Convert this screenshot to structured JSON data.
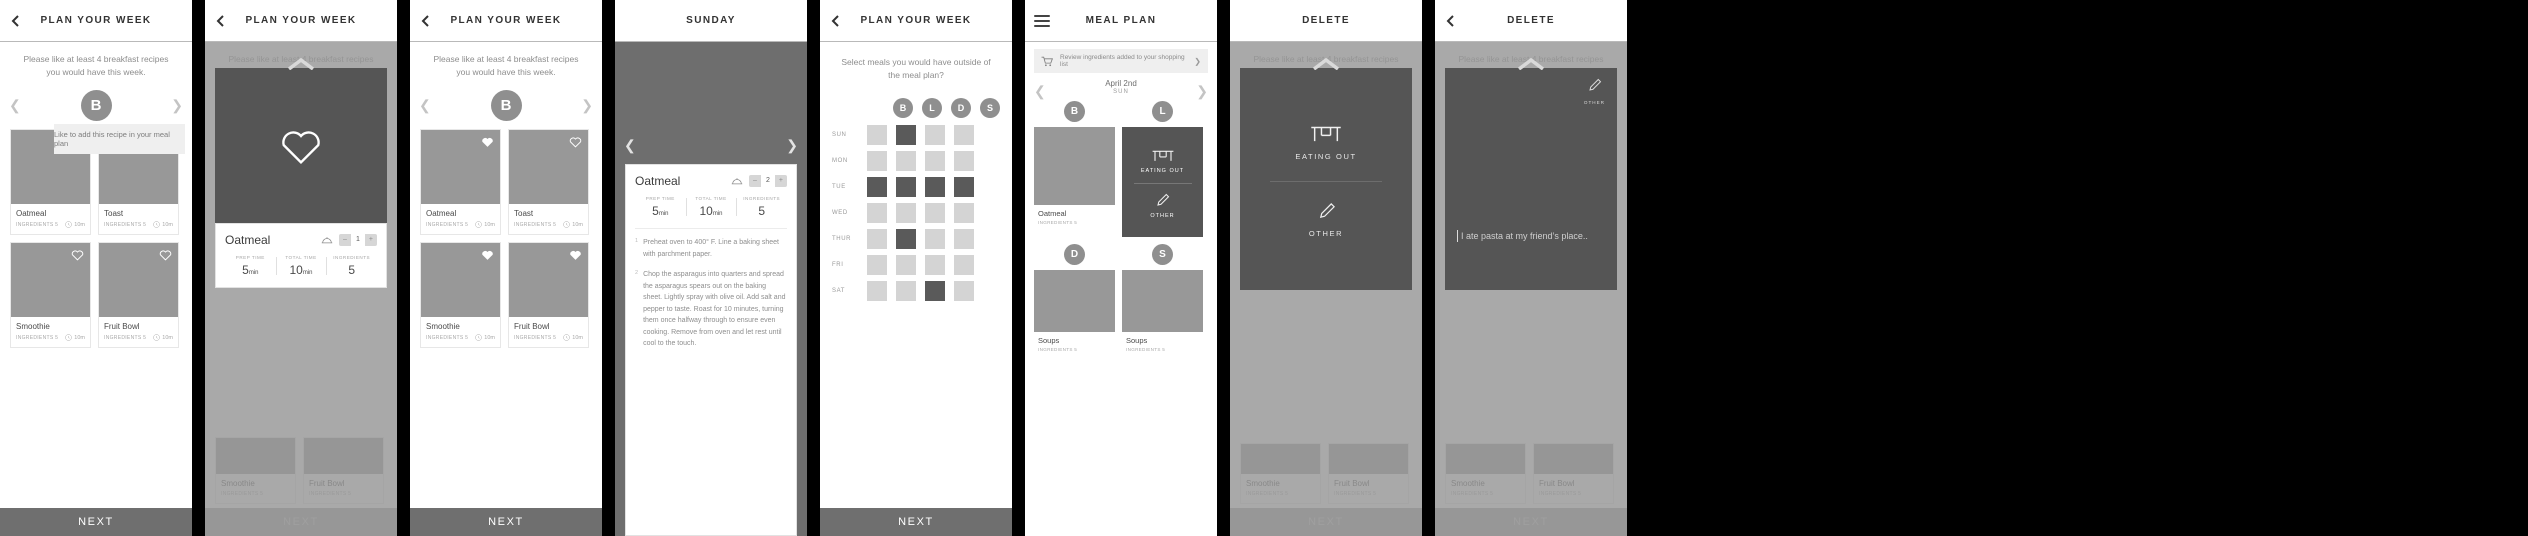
{
  "app": {
    "instruction": "Please like at least 4 breakfast recipes you would have this week.",
    "next_label": "NEXT"
  },
  "icons": {
    "back": "chevron-left-icon",
    "menu": "hamburger-menu-icon",
    "heart_outline": "heart-outline-icon",
    "heart_filled": "heart-filled-icon",
    "clock": "clock-icon",
    "dish": "dish-cloche-icon",
    "cart": "shopping-cart-icon",
    "table": "dining-table-icon",
    "pencil": "pencil-icon",
    "caret_up": "caret-up-icon"
  },
  "panels": [
    {
      "id": "plan-week-tooltip",
      "title": "PLAN YOUR WEEK",
      "day_letter": "B",
      "tooltip": "Like to add this recipe in your meal plan",
      "recipes": [
        {
          "name": "Oatmeal",
          "ingredients": "INGREDIENTS 5",
          "time": "10m",
          "liked": false
        },
        {
          "name": "Toast",
          "ingredients": "INGREDIENTS 5",
          "time": "10m",
          "liked": false
        },
        {
          "name": "Smoothie",
          "ingredients": "INGREDIENTS 5",
          "time": "10m",
          "liked": false
        },
        {
          "name": "Fruit Bowl",
          "ingredients": "INGREDIENTS 5",
          "time": "10m",
          "liked": false
        }
      ]
    },
    {
      "id": "plan-week-like-modal",
      "title": "PLAN YOUR WEEK",
      "detail": {
        "name": "Oatmeal",
        "servings": "1",
        "minus": "–",
        "plus": "+",
        "stats": [
          {
            "label": "PREP TIME",
            "value": "5",
            "unit": "min"
          },
          {
            "label": "TOTAL TIME",
            "value": "10",
            "unit": "min"
          },
          {
            "label": "INGREDIENTS",
            "value": "5",
            "unit": ""
          }
        ]
      },
      "ghost_recipes": [
        {
          "name": "Smoothie",
          "ingredients": "INGREDIENTS 5",
          "time": "10m"
        },
        {
          "name": "Fruit Bowl",
          "ingredients": "INGREDIENTS 5",
          "time": "10m"
        }
      ]
    },
    {
      "id": "plan-week-liked",
      "title": "PLAN YOUR WEEK",
      "day_letter": "B",
      "recipes": [
        {
          "name": "Oatmeal",
          "ingredients": "INGREDIENTS 5",
          "time": "10m",
          "liked": true
        },
        {
          "name": "Toast",
          "ingredients": "INGREDIENTS 5",
          "time": "10m",
          "liked": false
        },
        {
          "name": "Smoothie",
          "ingredients": "INGREDIENTS 5",
          "time": "10m",
          "liked": true
        },
        {
          "name": "Fruit Bowl",
          "ingredients": "INGREDIENTS 5",
          "time": "10m",
          "liked": true
        }
      ]
    },
    {
      "id": "sunday-recipe-detail",
      "title": "SUNDAY",
      "detail": {
        "name": "Oatmeal",
        "servings": "2",
        "minus": "–",
        "plus": "+",
        "stats": [
          {
            "label": "PREP TIME",
            "value": "5",
            "unit": "min"
          },
          {
            "label": "TOTAL TIME",
            "value": "10",
            "unit": "min"
          },
          {
            "label": "INGREDIENTS",
            "value": "5",
            "unit": ""
          }
        ],
        "steps": [
          {
            "num": "1",
            "text": "Preheat oven to 400° F. Line a baking sheet with parchment paper."
          },
          {
            "num": "2",
            "text": "Chop the asparagus into quarters and spread the asparagus spears out on the baking sheet. Lightly spray with olive oil. Add salt and pepper to taste. Roast for 10 minutes, turning them once halfway through to ensure even cooking. Remove from oven and let rest until cool to the touch."
          }
        ]
      }
    },
    {
      "id": "meal-matrix",
      "title": "PLAN YOUR WEEK",
      "instruction": "Select meals you would have outside of the meal plan?",
      "columns": [
        "B",
        "L",
        "D",
        "S"
      ],
      "rows": [
        {
          "day": "SUN",
          "cells": [
            0,
            1,
            0,
            0
          ]
        },
        {
          "day": "MON",
          "cells": [
            0,
            0,
            0,
            0
          ]
        },
        {
          "day": "TUE",
          "cells": [
            1,
            1,
            1,
            1
          ]
        },
        {
          "day": "WED",
          "cells": [
            0,
            0,
            0,
            0
          ]
        },
        {
          "day": "THUR",
          "cells": [
            0,
            1,
            0,
            0
          ]
        },
        {
          "day": "FRI",
          "cells": [
            0,
            0,
            0,
            0
          ]
        },
        {
          "day": "SAT",
          "cells": [
            0,
            0,
            1,
            0
          ]
        }
      ],
      "next_label": "NEXT"
    },
    {
      "id": "meal-plan",
      "title": "MEAL PLAN",
      "shopping_banner": "Review ingredients added to your shopping list",
      "date_primary": "April 2nd",
      "date_secondary": "SUN",
      "slots": [
        {
          "badge": "B",
          "type": "recipe",
          "name": "Oatmeal",
          "ingredients": "INGREDIENTS 5"
        },
        {
          "badge": "L",
          "type": "choice",
          "options": [
            "EATING OUT",
            "OTHER"
          ]
        },
        {
          "badge": "D",
          "type": "recipe",
          "name": "Soups",
          "ingredients": "INGREDIENTS 5"
        },
        {
          "badge": "S",
          "type": "recipe",
          "name": "Soups",
          "ingredients": "INGREDIENTS 5"
        }
      ]
    },
    {
      "id": "delete-eating-out",
      "title": "DELETE",
      "sheet": {
        "primary_label": "EATING OUT",
        "secondary_label": "OTHER"
      },
      "ghost_recipes": [
        {
          "name": "Smoothie",
          "ingredients": "INGREDIENTS 5"
        },
        {
          "name": "Fruit Bowl",
          "ingredients": "INGREDIENTS 5"
        }
      ],
      "next_label": "NEXT"
    },
    {
      "id": "delete-other-note",
      "title": "DELETE",
      "sheet": {
        "pencil_label": "OTHER",
        "note_text": "I ate pasta at my friend’s place.."
      },
      "ghost_recipes": [
        {
          "name": "Smoothie",
          "ingredients": "INGREDIENTS 5"
        },
        {
          "name": "Fruit Bowl",
          "ingredients": "INGREDIENTS 5"
        }
      ],
      "next_label": "NEXT"
    }
  ]
}
